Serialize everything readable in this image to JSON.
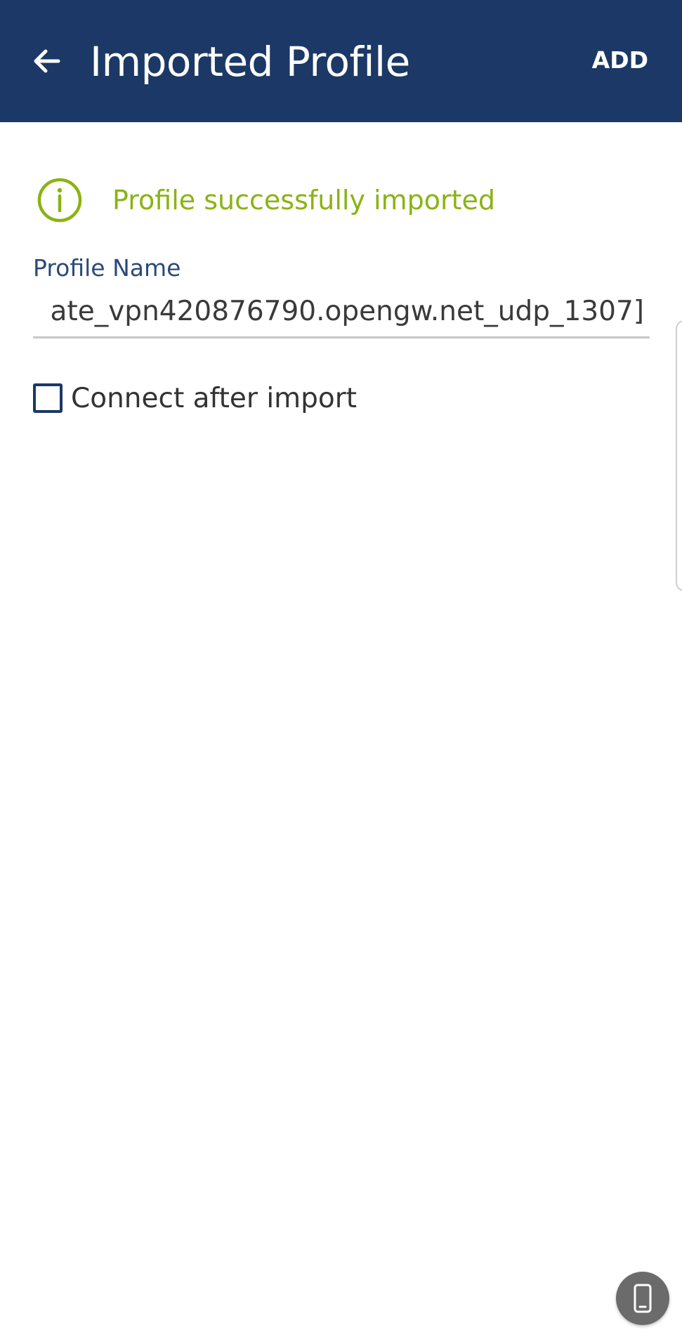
{
  "header": {
    "title": "Imported Profile",
    "add_label": "ADD",
    "background_color": "#1b3866"
  },
  "status": {
    "message": "Profile successfully imported",
    "icon": "info-icon",
    "color": "#8ab313"
  },
  "profile_name": {
    "label": "Profile Name",
    "value": "ate_vpn420876790.opengw.net_udp_1307]"
  },
  "connect_after_import": {
    "label": "Connect after import",
    "checked": false
  },
  "floating_button": {
    "icon": "phone-icon"
  }
}
